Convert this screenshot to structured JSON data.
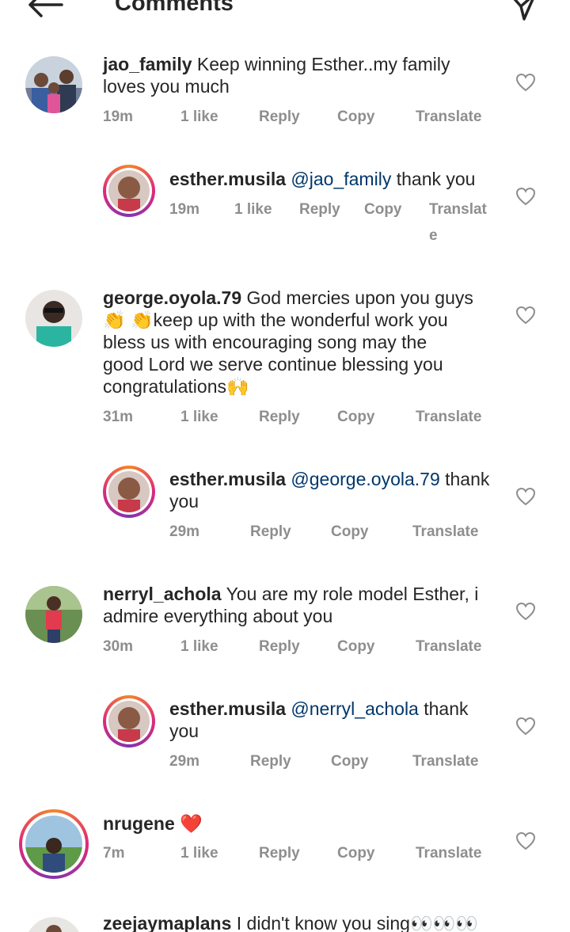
{
  "header": {
    "title": "Comments"
  },
  "actions": {
    "reply": "Reply",
    "copy": "Copy",
    "translate": "Translate",
    "translate_wrap_a": "Translat",
    "translate_wrap_b": "e"
  },
  "comments": [
    {
      "user": "jao_family",
      "text": "Keep winning Esther..my family",
      "text2": "loves you much",
      "time": "19m",
      "likes": "1 like"
    },
    {
      "user": "esther.musila",
      "mention": "@jao_family",
      "text": "thank you",
      "time": "19m",
      "likes": "1 like"
    },
    {
      "user": "george.oyola.79",
      "text": "God mercies upon you guys",
      "line2": "👏 👏keep up with the wonderful work you",
      "line3": "bless us with encouraging song may the",
      "line4": "good Lord we serve continue blessing you",
      "line5": "congratulations🙌",
      "time": "31m",
      "likes": "1 like"
    },
    {
      "user": "esther.musila",
      "mention": "@george.oyola.79",
      "text": "thank",
      "line2": "you",
      "time": "29m"
    },
    {
      "user": "nerryl_achola",
      "text": "You are my role model Esther, i",
      "line2": "admire everything about you",
      "time": "30m",
      "likes": "1 like"
    },
    {
      "user": "esther.musila",
      "mention": "@nerryl_achola",
      "text": "thank",
      "line2": "you",
      "time": "29m"
    },
    {
      "user": "nrugene",
      "text": "❤️",
      "time": "7m",
      "likes": "1 like"
    },
    {
      "user": "zeejaymaplans",
      "text": "I didn't know you sing👀👀👀"
    }
  ],
  "icons": {
    "back": "arrow-left-icon",
    "send": "direct-send-icon",
    "heart": "heart-outline-icon"
  }
}
